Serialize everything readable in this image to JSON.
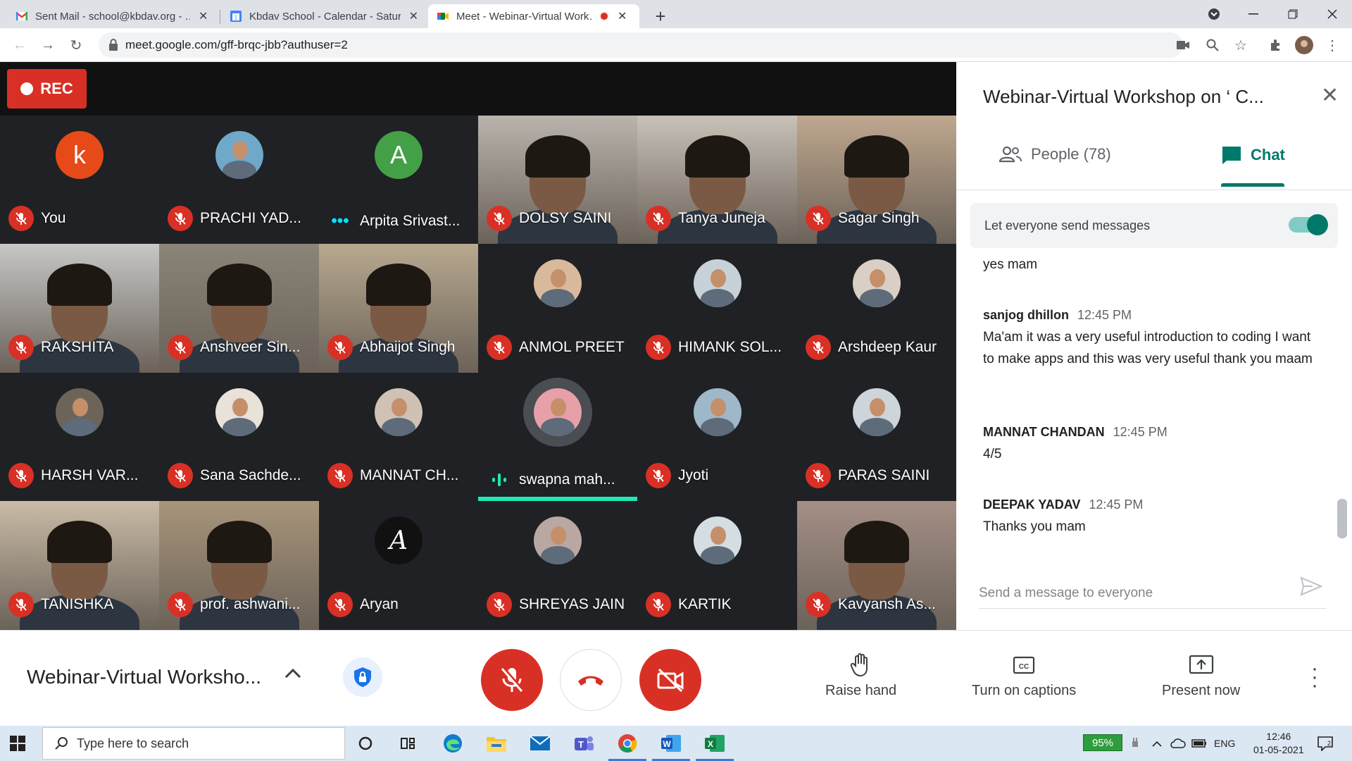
{
  "browser": {
    "tabs": [
      {
        "title": "Sent Mail - school@kbdav.org - …",
        "close": "✕"
      },
      {
        "title": "Kbdav School - Calendar - Saturd…",
        "close": "✕"
      },
      {
        "title": "Meet - Webinar-Virtual Work…",
        "close": "✕"
      }
    ],
    "new_tab": "+",
    "url": "meet.google.com/gff-brqc-jbb?authuser=2"
  },
  "meet": {
    "rec_label": "REC",
    "tiles": [
      {
        "name": "You",
        "kind": "avatar",
        "initial": "k",
        "color": "#e64a19",
        "status": "muted"
      },
      {
        "name": "PRACHI YAD...",
        "kind": "photo",
        "color": "#6fa8c9",
        "status": "muted"
      },
      {
        "name": "Arpita Srivast...",
        "kind": "avatar",
        "initial": "A",
        "color": "#43a047",
        "status": "speaking"
      },
      {
        "name": "DOLSY SAINI",
        "kind": "video",
        "color": "#b9b4ad",
        "status": "muted"
      },
      {
        "name": "Tanya Juneja",
        "kind": "video",
        "color": "#c9c2b8",
        "status": "muted"
      },
      {
        "name": "Sagar Singh",
        "kind": "video",
        "color": "#bfa78f",
        "status": "muted"
      },
      {
        "name": "RAKSHITA",
        "kind": "video",
        "color": "#c7c7c7",
        "status": "muted"
      },
      {
        "name": "Anshveer Sin...",
        "kind": "video",
        "color": "#8a8578",
        "status": "muted"
      },
      {
        "name": "Abhaijot Singh",
        "kind": "video",
        "color": "#b8a98f",
        "status": "muted"
      },
      {
        "name": "ANMOL PREET",
        "kind": "photo",
        "color": "#d8b99b",
        "status": "muted"
      },
      {
        "name": "HIMANK SOL...",
        "kind": "photo",
        "color": "#c7d1d8",
        "status": "muted"
      },
      {
        "name": "Arshdeep Kaur",
        "kind": "photo",
        "color": "#d9cfc4",
        "status": "muted"
      },
      {
        "name": "HARSH VAR...",
        "kind": "photo",
        "color": "#6d6459",
        "status": "muted"
      },
      {
        "name": "Sana Sachde...",
        "kind": "photo",
        "color": "#e8e2d8",
        "status": "muted"
      },
      {
        "name": "MANNAT CH...",
        "kind": "photo",
        "color": "#cfc2b5",
        "status": "muted"
      },
      {
        "name": "swapna mah...",
        "kind": "photo",
        "color": "#e7a0a8",
        "status": "talking"
      },
      {
        "name": "Jyoti",
        "kind": "photo",
        "color": "#9fb8c9",
        "status": "muted"
      },
      {
        "name": "PARAS SAINI",
        "kind": "photo",
        "color": "#cdd5db",
        "status": "muted"
      },
      {
        "name": "TANISHKA",
        "kind": "video",
        "color": "#c9bba6",
        "status": "muted"
      },
      {
        "name": "prof. ashwani...",
        "kind": "video",
        "color": "#a8957b",
        "status": "muted"
      },
      {
        "name": "Aryan",
        "kind": "avatar",
        "initial": "A",
        "color": "#111111",
        "status": "muted"
      },
      {
        "name": "SHREYAS JAIN",
        "kind": "photo",
        "color": "#b9a7a2",
        "status": "muted"
      },
      {
        "name": "KARTIK",
        "kind": "photo",
        "color": "#d4dde2",
        "status": "muted"
      },
      {
        "name": "Kavyansh As...",
        "kind": "video",
        "color": "#a48f86",
        "status": "muted"
      }
    ]
  },
  "panel": {
    "title": "Webinar-Virtual Workshop on ‘ C...",
    "close": "✕",
    "tab_people": "People (78)",
    "tab_chat": "Chat",
    "toggle_label": "Let everyone send messages",
    "messages": [
      {
        "sender": "",
        "time": "",
        "text": "yes mam"
      },
      {
        "sender": "sanjog dhillon",
        "time": "12:45 PM",
        "text": "Ma'am it was a very useful introduction to coding I want to make apps and this was very useful thank you maam"
      },
      {
        "sender": "MANNAT CHANDAN",
        "time": "12:45 PM",
        "text": "4/5"
      },
      {
        "sender": "DEEPAK YADAV",
        "time": "12:45 PM",
        "text": "Thanks  you mam"
      }
    ],
    "send_placeholder": "Send a message to everyone"
  },
  "bottom": {
    "meeting_title": "Webinar-Virtual Worksho...",
    "raise_hand": "Raise hand",
    "captions": "Turn on captions",
    "present": "Present now"
  },
  "taskbar": {
    "search_placeholder": "Type here to search",
    "battery": "95%",
    "lang": "ENG",
    "time": "12:46",
    "date": "01-05-2021"
  },
  "colors": {
    "accent": "#00796b",
    "danger": "#d93025",
    "meet_bg": "#202124"
  }
}
